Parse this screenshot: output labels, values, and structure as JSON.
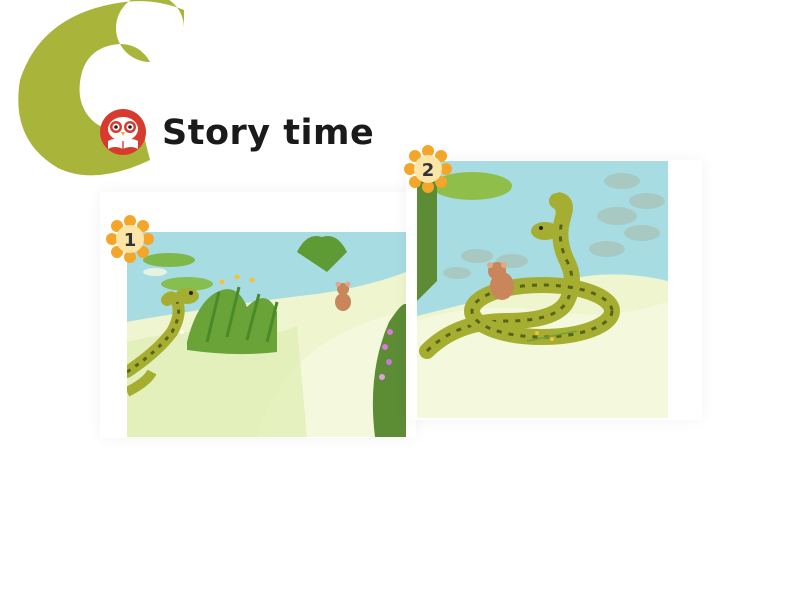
{
  "header": {
    "section_letter": "C",
    "title": "Story time"
  },
  "panels": [
    {
      "number": "1"
    },
    {
      "number": "2"
    }
  ],
  "colors": {
    "c_letter": "#a9b43a",
    "owl_red": "#d93a2e",
    "badge_orange": "#f4a62a",
    "pond": "#a8dce3",
    "meadow": "#eef5cf",
    "snake_green": "#a6ae32",
    "snake_dark": "#59621a"
  },
  "icons": {
    "logo": "owl-book-icon",
    "badge": "sunflower-badge-icon"
  }
}
